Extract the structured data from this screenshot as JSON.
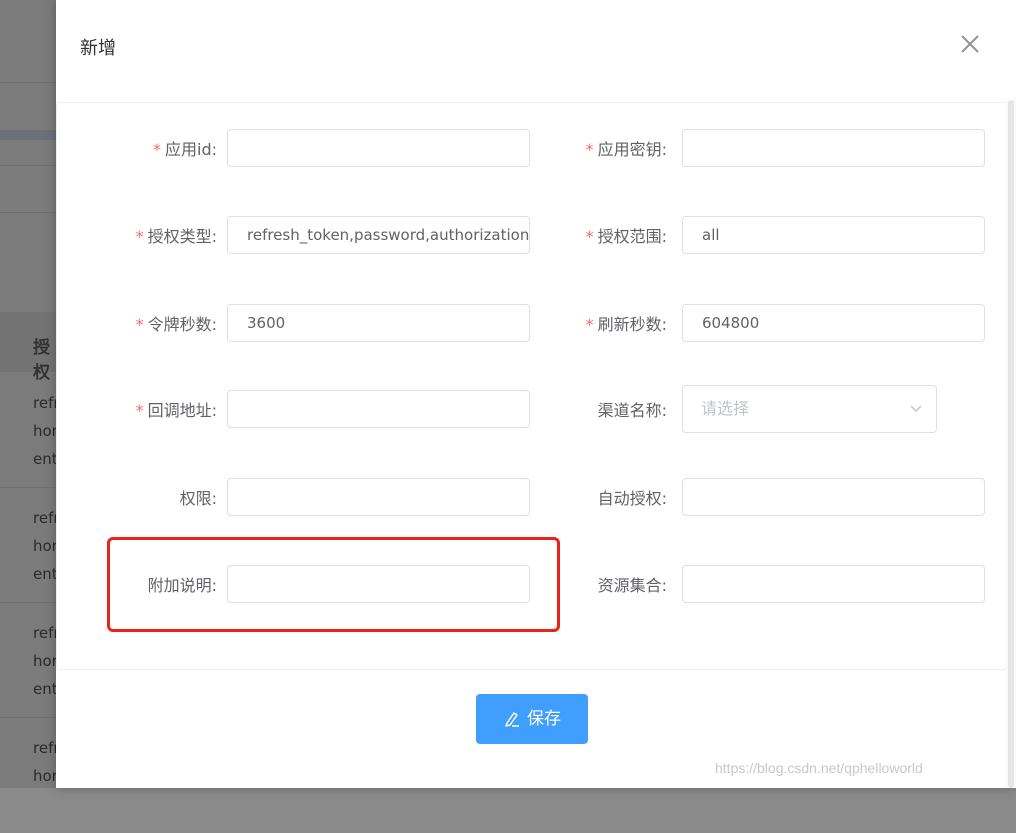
{
  "background": {
    "table_header": "授权",
    "rows": [
      [
        "refr",
        "hor",
        "ent"
      ],
      [
        "refr",
        "hor",
        "ent"
      ],
      [
        "refr",
        "hor",
        "ent"
      ],
      [
        "refr",
        "hor"
      ]
    ]
  },
  "dialog": {
    "title": "新增",
    "close_icon": "close-icon",
    "required_mark": "*",
    "fields": {
      "app_id": {
        "label": "应用id:",
        "value": "",
        "required": true
      },
      "app_secret": {
        "label": "应用密钥:",
        "value": "",
        "required": true
      },
      "grant_types": {
        "label": "授权类型:",
        "value": "refresh_token,password,authorization_code",
        "required": true
      },
      "scope": {
        "label": "授权范围:",
        "value": "all",
        "required": true
      },
      "token_seconds": {
        "label": "令牌秒数:",
        "value": "3600",
        "required": true
      },
      "refresh_seconds": {
        "label": "刷新秒数:",
        "value": "604800",
        "required": true
      },
      "redirect_url": {
        "label": "回调地址:",
        "value": "",
        "required": true
      },
      "channel_name": {
        "label": "渠道名称:",
        "placeholder": "请选择",
        "required": false
      },
      "authorities": {
        "label": "权限:",
        "value": "",
        "required": false
      },
      "auto_approve": {
        "label": "自动授权:",
        "value": "",
        "required": false
      },
      "additional_info": {
        "label": "附加说明:",
        "value": "",
        "required": false
      },
      "resource_ids": {
        "label": "资源集合:",
        "value": "",
        "required": false
      }
    },
    "save_button": {
      "label": "保存",
      "icon": "edit-icon"
    },
    "highlight_color": "#e8241a",
    "accent_color": "#409eff",
    "required_color": "#f56c6c"
  },
  "watermark": "https://blog.csdn.net/qphelloworld"
}
